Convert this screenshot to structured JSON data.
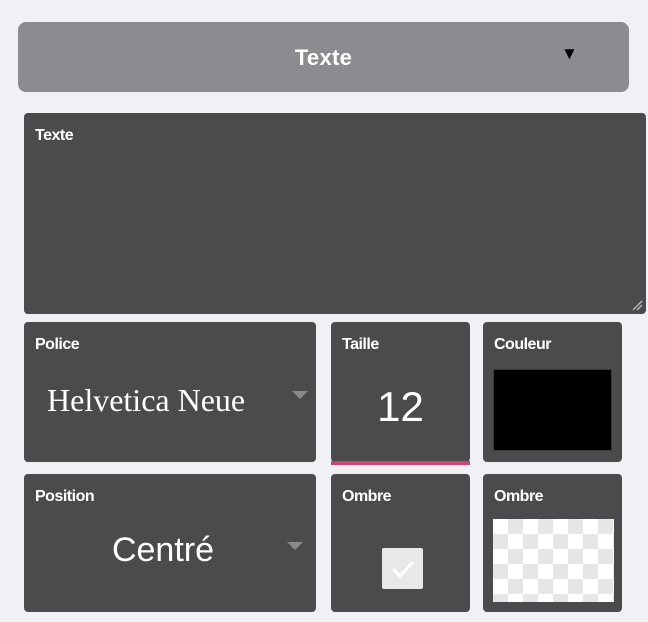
{
  "header": {
    "title": "Texte",
    "arrow_icon": "triangle-down-icon"
  },
  "text_panel": {
    "label": "Texte",
    "value": ""
  },
  "font_panel": {
    "label": "Police",
    "value": "Helvetica Neue"
  },
  "size_panel": {
    "label": "Taille",
    "value": "12",
    "underline_color": "#c84775"
  },
  "color_panel": {
    "label": "Couleur",
    "color": "#000000"
  },
  "position_panel": {
    "label": "Position",
    "value": "Centré"
  },
  "shadow_toggle_panel": {
    "label": "Ombre",
    "checked": true
  },
  "shadow_color_panel": {
    "label": "Ombre",
    "color": "transparent"
  }
}
